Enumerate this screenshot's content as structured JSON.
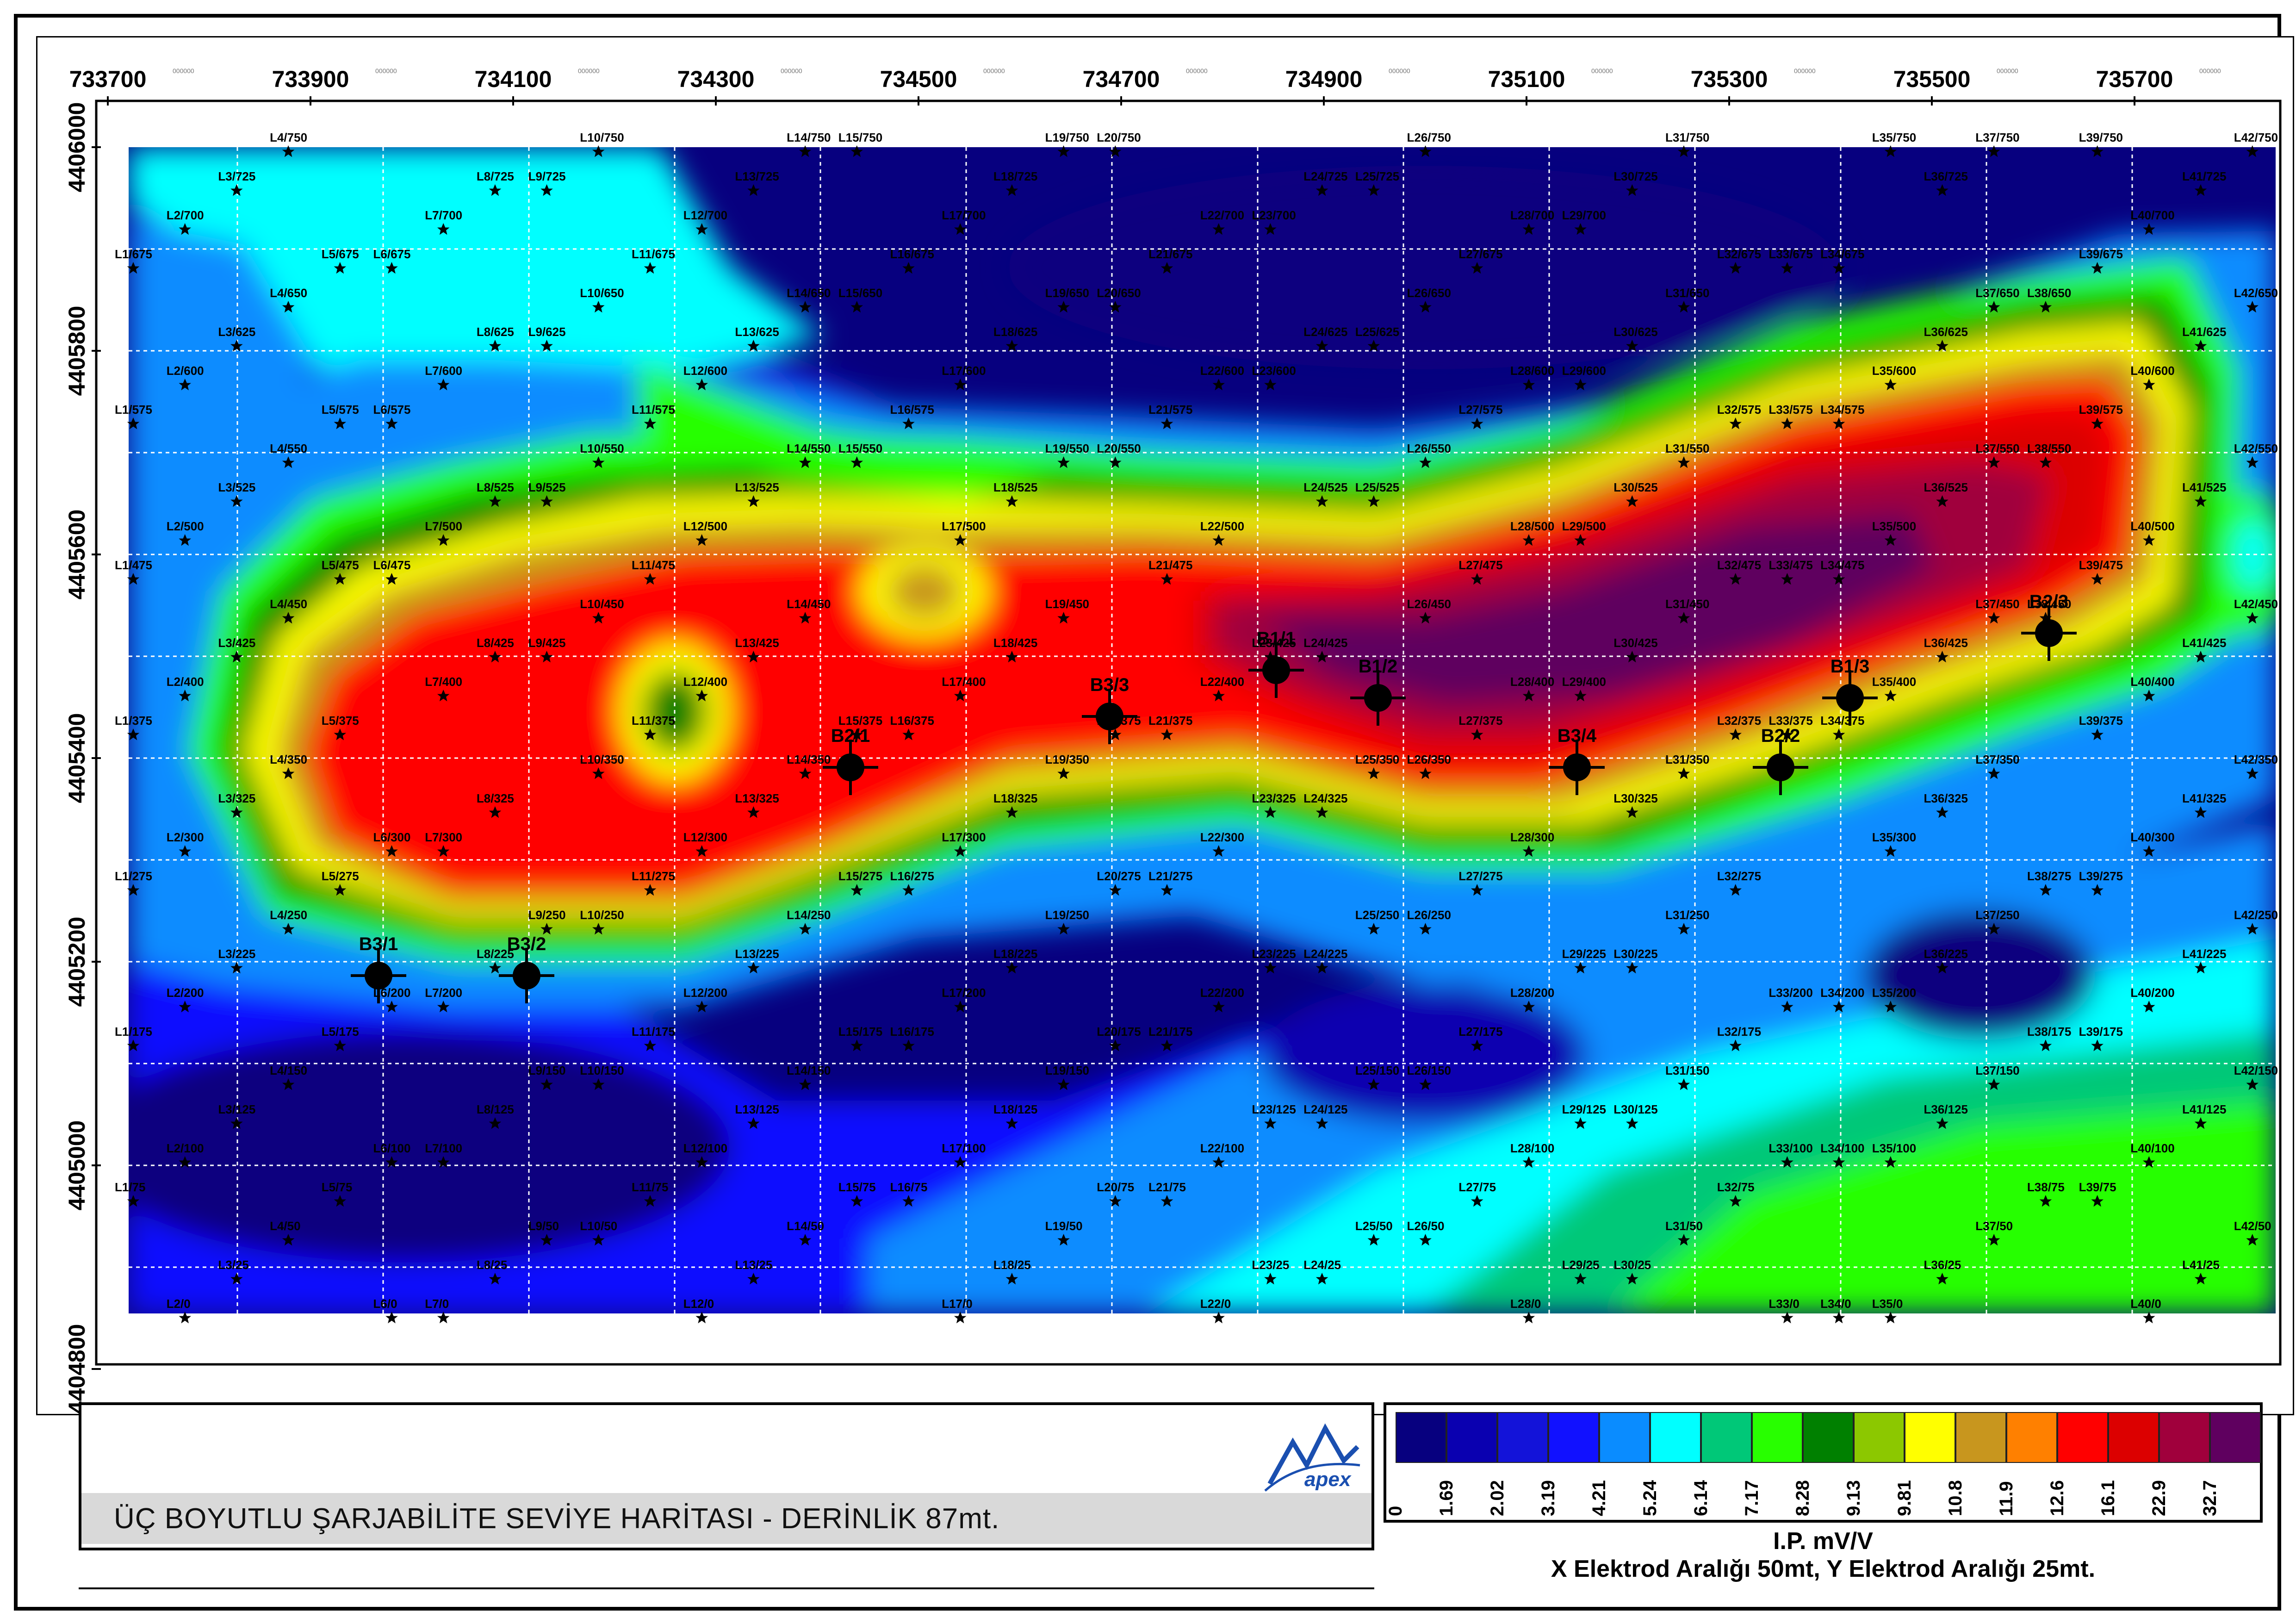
{
  "map": {
    "x_axis": {
      "labels": [
        "733700",
        "733900",
        "734100",
        "734300",
        "734500",
        "734700",
        "734900",
        "735100",
        "735300",
        "735500",
        "735700"
      ],
      "sub_label": "000000"
    },
    "y_axis": {
      "labels": [
        "4406000",
        "4405800",
        "4405600",
        "4405400",
        "4405200",
        "4405000",
        "4404800"
      ]
    },
    "stations": [
      "L1/675",
      "L1/575",
      "L1/475",
      "L1/375",
      "L1/275",
      "L1/175",
      "L1/75",
      "L2/700",
      "L2/600",
      "L2/500",
      "L2/400",
      "L2/300",
      "L2/200",
      "L2/100",
      "L2/0",
      "L3/725",
      "L3/625",
      "L3/525",
      "L3/425",
      "L3/325",
      "L3/225",
      "L3/125",
      "L3/25",
      "L4/750",
      "L4/650",
      "L4/550",
      "L4/450",
      "L4/350",
      "L4/250",
      "L4/150",
      "L4/50",
      "L5/675",
      "L5/575",
      "L5/475",
      "L5/375",
      "L5/275",
      "L5/175",
      "L5/75",
      "L6/675",
      "L6/575",
      "L6/475",
      "L6/300",
      "L6/200",
      "L6/100",
      "L6/0",
      "L7/700",
      "L7/600",
      "L7/500",
      "L7/400",
      "L7/300",
      "L7/200",
      "L7/100",
      "L7/0",
      "L8/725",
      "L8/625",
      "L8/525",
      "L8/425",
      "L8/325",
      "L8/225",
      "L8/125",
      "L8/25",
      "L9/725",
      "L9/625",
      "L9/525",
      "L9/425",
      "L9/250",
      "L9/150",
      "L9/50",
      "L10/750",
      "L10/650",
      "L10/550",
      "L10/450",
      "L10/350",
      "L10/250",
      "L10/150",
      "L10/50",
      "L11/675",
      "L11/575",
      "L11/475",
      "L11/375",
      "L11/275",
      "L11/175",
      "L11/75",
      "L12/700",
      "L12/600",
      "L12/500",
      "L12/400",
      "L12/300",
      "L12/200",
      "L12/100",
      "L12/0",
      "L13/725",
      "L13/625",
      "L13/525",
      "L13/425",
      "L13/325",
      "L13/225",
      "L13/125",
      "L13/25",
      "L14/750",
      "L14/650",
      "L14/550",
      "L14/450",
      "L14/350",
      "L14/250",
      "L14/150",
      "L14/50",
      "L15/750",
      "L15/650",
      "L15/550",
      "L15/375",
      "L15/275",
      "L15/175",
      "L15/75",
      "L16/675",
      "L16/575",
      "L16/375",
      "L16/275",
      "L16/175",
      "L16/75",
      "L17/700",
      "L17/600",
      "L17/500",
      "L17/400",
      "L17/300",
      "L17/200",
      "L17/100",
      "L17/0",
      "L18/725",
      "L18/625",
      "L18/525",
      "L18/425",
      "L18/325",
      "L18/225",
      "L18/125",
      "L18/25",
      "L19/750",
      "L19/650",
      "L19/550",
      "L19/450",
      "L19/350",
      "L19/250",
      "L19/150",
      "L19/50",
      "L20/750",
      "L20/650",
      "L20/550",
      "L20/375",
      "L20/275",
      "L20/175",
      "L20/75",
      "L21/675",
      "L21/575",
      "L21/475",
      "L21/375",
      "L21/275",
      "L21/175",
      "L21/75",
      "L22/700",
      "L22/600",
      "L22/500",
      "L22/400",
      "L22/300",
      "L22/200",
      "L22/100",
      "L22/0",
      "L23/700",
      "L23/600",
      "L23/425",
      "L23/325",
      "L23/225",
      "L23/125",
      "L23/25",
      "L24/725",
      "L24/625",
      "L24/525",
      "L24/425",
      "L24/325",
      "L24/225",
      "L24/125",
      "L24/25",
      "L25/725",
      "L25/625",
      "L25/525",
      "L25/350",
      "L25/250",
      "L25/150",
      "L25/50",
      "L26/750",
      "L26/650",
      "L26/550",
      "L26/450",
      "L26/350",
      "L26/250",
      "L26/150",
      "L26/50",
      "L27/675",
      "L27/575",
      "L27/475",
      "L27/375",
      "L27/275",
      "L27/175",
      "L27/75",
      "L28/700",
      "L28/600",
      "L28/500",
      "L28/400",
      "L28/300",
      "L28/200",
      "L28/100",
      "L28/0",
      "L29/700",
      "L29/600",
      "L29/500",
      "L29/400",
      "L29/225",
      "L29/125",
      "L29/25",
      "L30/725",
      "L30/625",
      "L30/525",
      "L30/425",
      "L30/325",
      "L30/225",
      "L30/125",
      "L30/25",
      "L31/750",
      "L31/650",
      "L31/550",
      "L31/450",
      "L31/350",
      "L31/250",
      "L31/150",
      "L31/50",
      "L32/675",
      "L32/575",
      "L32/475",
      "L32/375",
      "L32/275",
      "L32/175",
      "L32/75",
      "L33/675",
      "L33/575",
      "L33/475",
      "L33/375",
      "L33/200",
      "L33/100",
      "L33/0",
      "L34/675",
      "L34/575",
      "L34/475",
      "L34/375",
      "L34/200",
      "L34/100",
      "L34/0",
      "L35/750",
      "L35/600",
      "L35/500",
      "L35/400",
      "L35/300",
      "L35/200",
      "L35/100",
      "L35/0",
      "L36/725",
      "L36/625",
      "L36/525",
      "L36/425",
      "L36/325",
      "L36/225",
      "L36/125",
      "L36/25",
      "L37/750",
      "L37/650",
      "L37/550",
      "L37/450",
      "L37/350",
      "L37/250",
      "L37/150",
      "L37/50",
      "L38/650",
      "L38/550",
      "L38/450",
      "L38/275",
      "L38/175",
      "L38/75",
      "L39/750",
      "L39/675",
      "L39/575",
      "L39/475",
      "L39/375",
      "L39/275",
      "L39/175",
      "L39/75",
      "L40/700",
      "L40/600",
      "L40/500",
      "L40/400",
      "L40/300",
      "L40/200",
      "L40/100",
      "L40/0",
      "L41/725",
      "L41/625",
      "L41/525",
      "L41/425",
      "L41/325",
      "L41/225",
      "L41/125",
      "L41/25",
      "L42/750",
      "L42/650",
      "L42/550",
      "L42/450",
      "L42/350",
      "L42/250",
      "L42/150",
      "L42/50"
    ],
    "boreholes": [
      "B3/1",
      "B3/2",
      "B2/1",
      "B3/3",
      "B1/1",
      "B1/2",
      "B3/4",
      "B2/2",
      "B1/3",
      "B2/3"
    ]
  },
  "title": {
    "text": "ÜÇ BOYUTLU ŞARJABİLİTE SEVİYE HARİTASI - DERİNLİK 87mt.",
    "logo_text": "apex"
  },
  "legend": {
    "colors": [
      "#07007f",
      "#0a00b0",
      "#1313d9",
      "#1111ff",
      "#0a8cff",
      "#00ffff",
      "#00c878",
      "#28ff00",
      "#008000",
      "#8cc800",
      "#ffff00",
      "#c8961e",
      "#ff8000",
      "#ff0000",
      "#dc0000",
      "#a0003c",
      "#5f005f"
    ],
    "labels": [
      "0",
      "1.69",
      "2.02",
      "3.19",
      "4.21",
      "5.24",
      "6.14",
      "7.17",
      "8.28",
      "9.13",
      "9.81",
      "10.8",
      "11.9",
      "12.6",
      "16.1",
      "22.9",
      "32.7"
    ],
    "unit": "I.P. mV/V",
    "spacing": "X Elektrod Aralığı 50mt, Y Elektrod Aralığı 25mt."
  }
}
